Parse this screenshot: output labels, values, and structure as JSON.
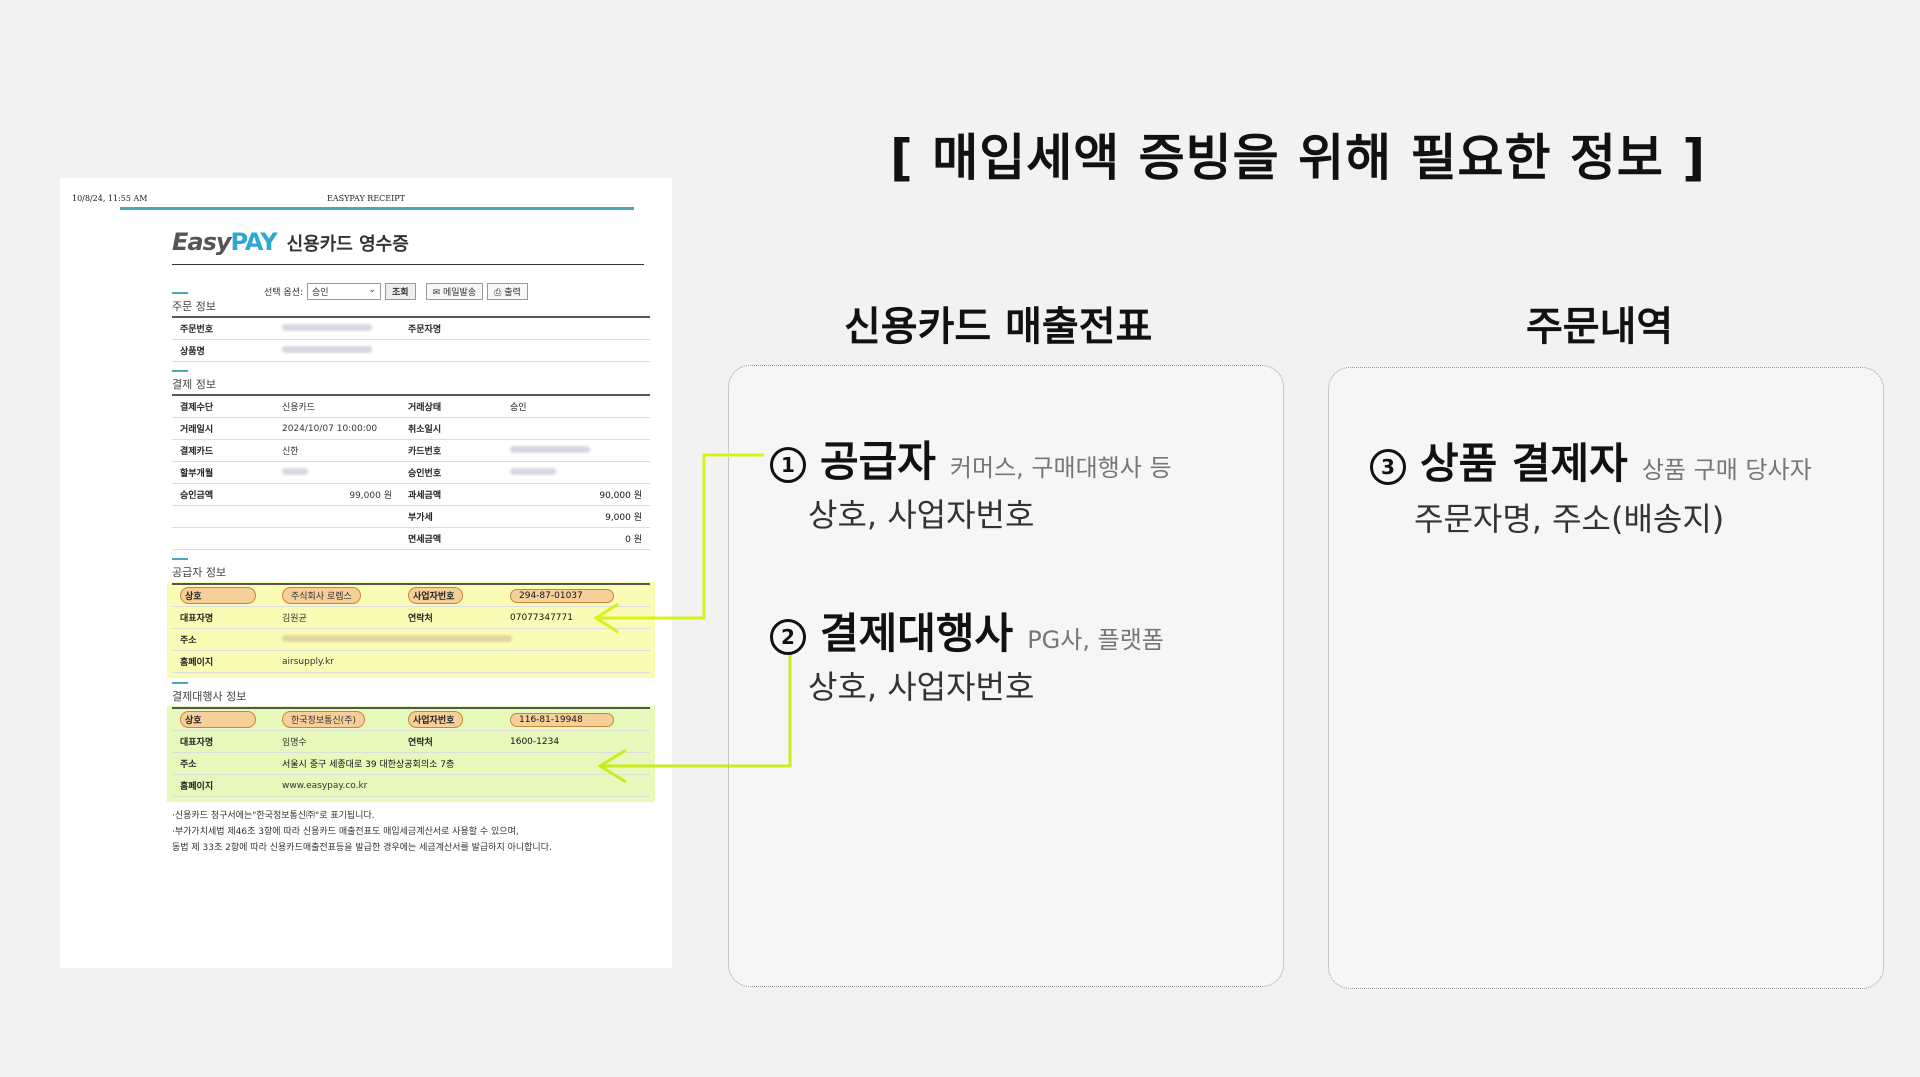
{
  "page": {
    "title": "[ 매입세액 증빙을 위해 필요한 정보 ]",
    "col_left_title": "신용카드 매출전표",
    "col_right_title": "주문내역",
    "items": [
      {
        "num": "1",
        "title": "공급자",
        "sub": "커머스, 구매대행사 등",
        "body": "상호, 사업자번호"
      },
      {
        "num": "2",
        "title": "결제대행사",
        "sub": "PG사, 플랫폼",
        "body": "상호, 사업자번호"
      },
      {
        "num": "3",
        "title": "상품 결제자",
        "sub": "상품 구매 당사자",
        "body": "주문자명, 주소(배송지)"
      }
    ],
    "arrow_color": "#d8f21a"
  },
  "receipt": {
    "datetime": "10/8/24, 11:55 AM",
    "header": "EASYPAY RECEIPT",
    "brand_easy": "Easy",
    "brand_pay": "PAY",
    "brand_title": "신용카드 영수증",
    "toolbar": {
      "option_label": "선택 옵션:",
      "option_value": "승인",
      "search": "조회",
      "mail": "메일발송",
      "print": "출력"
    },
    "order": {
      "section": "주문 정보",
      "order_no_label": "주문번호",
      "orderer_label": "주문자명",
      "product_label": "상품명"
    },
    "payment": {
      "section": "결제 정보",
      "rows": [
        {
          "k1": "결제수단",
          "v1": "신용카드",
          "k2": "거래상태",
          "v2": "승인"
        },
        {
          "k1": "거래일시",
          "v1": "2024/10/07 10:00:00",
          "k2": "취소일시",
          "v2": ""
        },
        {
          "k1": "결제카드",
          "v1": "신한",
          "k2": "카드번호",
          "v2": ""
        },
        {
          "k1": "할부개월",
          "v1": "",
          "k2": "승인번호",
          "v2": ""
        },
        {
          "k1": "승인금액",
          "v1": "99,000 원",
          "k2": "과세금액",
          "v2": "90,000 원"
        },
        {
          "k1": "",
          "v1": "",
          "k2": "부가세",
          "v2": "9,000 원"
        },
        {
          "k1": "",
          "v1": "",
          "k2": "면세금액",
          "v2": "0 원"
        }
      ]
    },
    "supplier": {
      "section": "공급자 정보",
      "name_label": "상호",
      "name": "주식회사 로렙스",
      "bizno_label": "사업자번호",
      "bizno": "294-87-01037",
      "rep_label": "대표자명",
      "rep": "김원균",
      "tel_label": "연락처",
      "tel": "07077347771",
      "addr_label": "주소",
      "home_label": "홈페이지",
      "home": "airsupply.kr"
    },
    "pg": {
      "section": "결제대행사 정보",
      "name_label": "상호",
      "name": "한국정보통신(주)",
      "bizno_label": "사업자번호",
      "bizno": "116-81-19948",
      "rep_label": "대표자명",
      "rep": "임명수",
      "tel_label": "연락처",
      "tel": "1600-1234",
      "addr_label": "주소",
      "addr": "서울시 중구 세종대로 39 대한상공회의소 7층",
      "home_label": "홈페이지",
      "home": "www.easypay.co.kr"
    },
    "notes": [
      "·신용카드 청구서에는\"한국정보통신㈜\"로 표기됩니다.",
      "·부가가치세법 제46조 3항에 따라 신용카드 매출전표도 매입세금계산서로 사용할 수 있으며,",
      "동법 제 33조 2항에 따라 신용카드매출전표등을 발급한 경우에는 세금계산서를 발급하지 아니합니다."
    ]
  }
}
